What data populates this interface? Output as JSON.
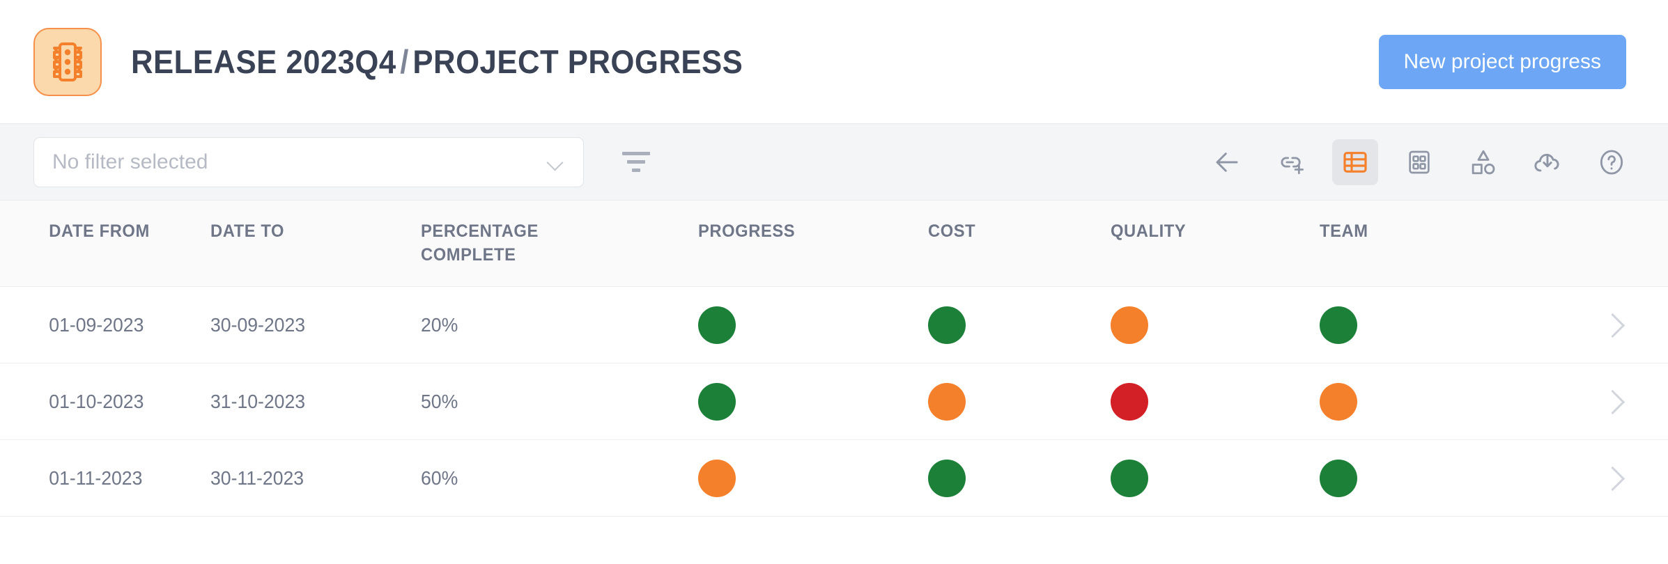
{
  "header": {
    "app_icon": "traffic-light-icon",
    "icon_bg_color": "#FCD9AC",
    "icon_accent_color": "#F5904A",
    "title_part1": "RELEASE 2023Q4",
    "title_separator": "/",
    "title_part2": "PROJECT PROGRESS",
    "title_color": "#3A4256",
    "new_button_label": "New project progress",
    "new_button_color": "#6CA6F5"
  },
  "toolbar": {
    "filter_placeholder": "No filter selected",
    "filter_value": "",
    "icons": [
      {
        "name": "back-arrow-icon",
        "active": false
      },
      {
        "name": "link-add-icon",
        "active": false
      },
      {
        "name": "table-view-icon",
        "active": true
      },
      {
        "name": "card-view-icon",
        "active": false
      },
      {
        "name": "shapes-icon",
        "active": false
      },
      {
        "name": "cloud-download-icon",
        "active": false
      },
      {
        "name": "help-icon",
        "active": false
      }
    ],
    "active_icon_color": "#F5802B",
    "icon_color": "#8F96A6"
  },
  "table": {
    "columns": [
      {
        "key": "date_from",
        "label": "DATE FROM"
      },
      {
        "key": "date_to",
        "label": "DATE TO"
      },
      {
        "key": "percentage_complete",
        "label": "PERCENTAGE COMPLETE",
        "line1": "PERCENTAGE",
        "line2": "COMPLETE"
      },
      {
        "key": "progress",
        "label": "PROGRESS"
      },
      {
        "key": "cost",
        "label": "COST"
      },
      {
        "key": "quality",
        "label": "QUALITY"
      },
      {
        "key": "team",
        "label": "TEAM"
      }
    ],
    "status_colors": {
      "green": "#1C8038",
      "orange": "#F5802B",
      "red": "#D32027"
    },
    "rows": [
      {
        "date_from": "01-09-2023",
        "date_to": "30-09-2023",
        "percentage_complete": "20%",
        "progress": "green",
        "cost": "green",
        "quality": "orange",
        "team": "green"
      },
      {
        "date_from": "01-10-2023",
        "date_to": "31-10-2023",
        "percentage_complete": "50%",
        "progress": "green",
        "cost": "orange",
        "quality": "red",
        "team": "orange"
      },
      {
        "date_from": "01-11-2023",
        "date_to": "30-11-2023",
        "percentage_complete": "60%",
        "progress": "orange",
        "cost": "green",
        "quality": "green",
        "team": "green"
      }
    ]
  }
}
